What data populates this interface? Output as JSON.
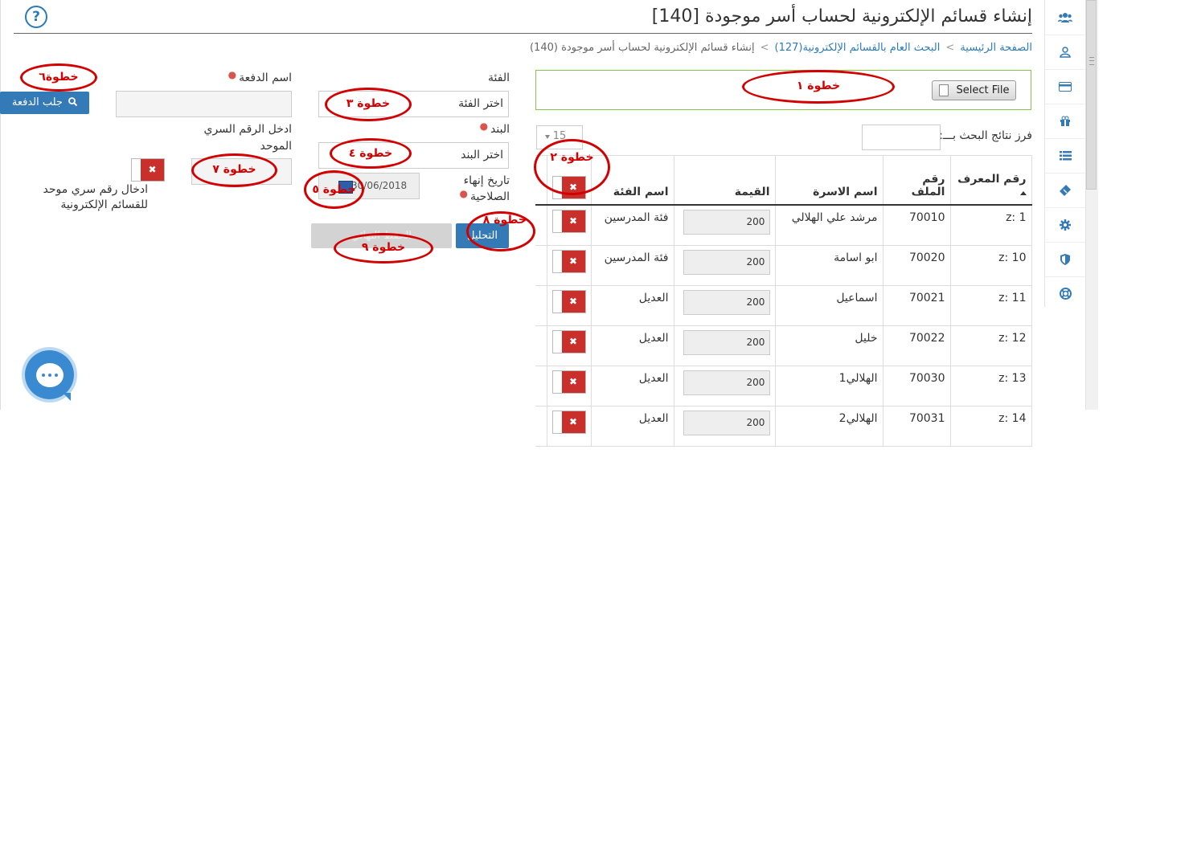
{
  "header": {
    "title": "إنشاء قسائم الإلكترونية لحساب أسر موجودة [140]",
    "help_glyph": "?"
  },
  "breadcrumb": {
    "items": [
      "الصفحة الرئيسية",
      "البحث العام بالقسائم الإلكترونية(127)",
      "إنشاء قسائم الإلكترونية لحساب أسر موجودة (140)"
    ],
    "separator": ">"
  },
  "sidebar": {
    "icons": [
      "users-icon",
      "user-icon",
      "card-icon",
      "gift-icon",
      "list-icon",
      "ticket-icon",
      "gear-icon",
      "shield-icon",
      "lifebuoy-icon"
    ]
  },
  "upload": {
    "button_label": "Select File"
  },
  "table_controls": {
    "sort_label": "فرز نتائج البحث بـــ:",
    "page_size": "15"
  },
  "table": {
    "columns": [
      "رقم المعرف",
      "رقم الملف",
      "اسم الاسرة",
      "القيمة",
      "اسم الفئة"
    ],
    "rows": [
      {
        "id": "z: 1",
        "file": "70010",
        "family": "مرشد علي الهلالي",
        "value": "200",
        "category": "فئة المدرسين"
      },
      {
        "id": "z: 10",
        "file": "70020",
        "family": "ابو اسامة",
        "value": "200",
        "category": "فئة المدرسين"
      },
      {
        "id": "z: 11",
        "file": "70021",
        "family": "اسماعيل",
        "value": "200",
        "category": "العديل"
      },
      {
        "id": "z: 12",
        "file": "70022",
        "family": "خليل",
        "value": "200",
        "category": "العديل"
      },
      {
        "id": "z: 13",
        "file": "70030",
        "family": "الهلالي1",
        "value": "200",
        "category": "العديل"
      },
      {
        "id": "z: 14",
        "file": "70031",
        "family": "الهلالي2",
        "value": "200",
        "category": "العديل"
      }
    ]
  },
  "form": {
    "category_label": "الفئة",
    "category_placeholder": "اختر الفئة",
    "item_label": "البند",
    "item_placeholder": "اختر البند",
    "expiry_label_1": "تاريخ إنهاء",
    "expiry_label_2": "الصلاحية",
    "expiry_value": "30/06/2018",
    "analyze_button": "التحليل",
    "final_save_button": "الحفظ النهائي",
    "batch_name_label": "اسم الدفعة",
    "fetch_batch_button": "جلب الدفعة",
    "pin_label_1": "ادخل الرقم السري",
    "pin_label_2": "الموحد",
    "unified_pin_label_1": "ادخال رقم سري موحد",
    "unified_pin_label_2": "للقسائم الإلكترونية",
    "toggle_off_glyph": "✖"
  },
  "annotations": {
    "step1": "خطوة ١",
    "step2": "خطوة ٢",
    "step3": "خطوة ٣",
    "step4": "خطوة ٤",
    "step5": "خطوة ٥",
    "step6": "خطوة٦",
    "step7": "خطوة ٧",
    "step8": "خطوة ٨",
    "step9": "خطوة ٩"
  },
  "colors": {
    "primary": "#337ab7",
    "danger": "#c9302c",
    "annotation": "#d30000",
    "upload_border": "#8bc34a"
  }
}
